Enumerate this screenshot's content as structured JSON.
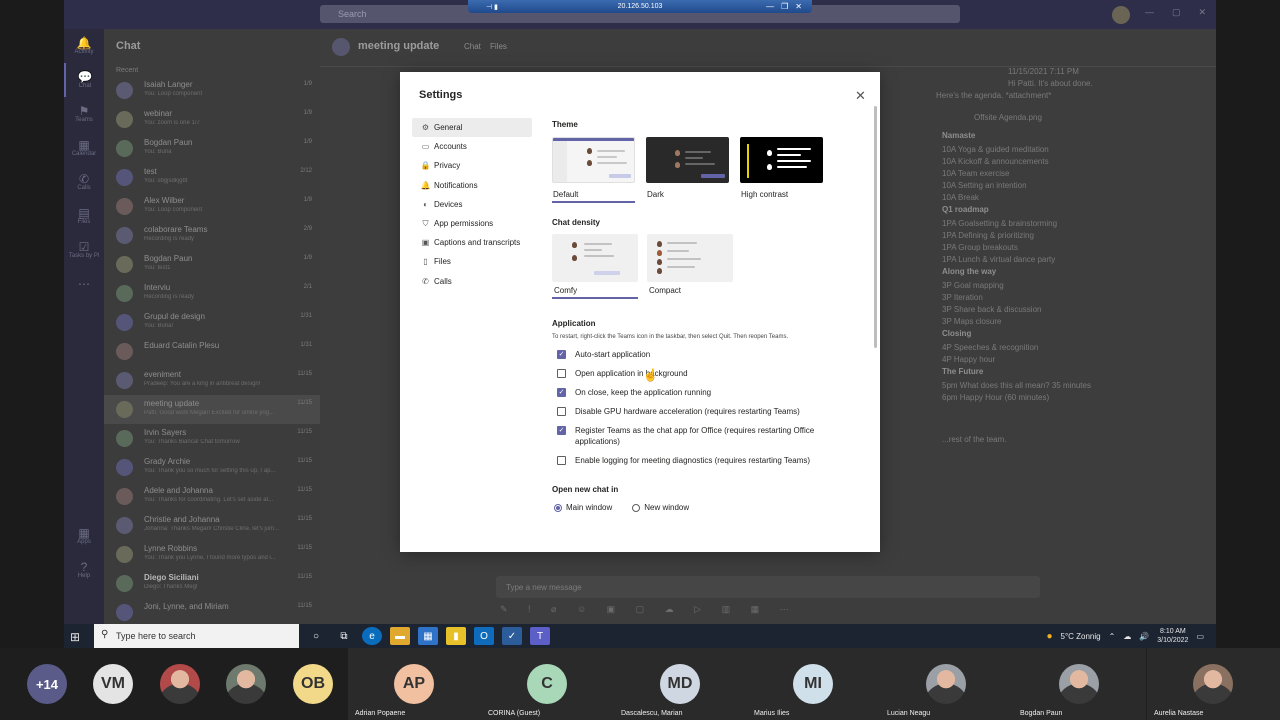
{
  "remote": {
    "host": "20.126.50.103",
    "teams": {
      "search_placeholder": "Search",
      "rail": [
        {
          "label": "Activity",
          "glyph": "🔔"
        },
        {
          "label": "Chat",
          "glyph": "💬"
        },
        {
          "label": "Teams",
          "glyph": "⚑"
        },
        {
          "label": "Calendar",
          "glyph": "▦"
        },
        {
          "label": "Calls",
          "glyph": "✆"
        },
        {
          "label": "Files",
          "glyph": "▤"
        },
        {
          "label": "Tasks by Pl",
          "glyph": "☑"
        },
        {
          "label": "",
          "glyph": "⋯"
        }
      ],
      "rail_bottom": [
        {
          "label": "Apps",
          "glyph": "▦"
        },
        {
          "label": "Help",
          "glyph": "?"
        }
      ],
      "chat_title": "Chat",
      "recent_label": "Recent",
      "chats": [
        {
          "name": "Isaiah Langer",
          "preview": "You: Loop component",
          "time": "1/9"
        },
        {
          "name": "webinar",
          "preview": "You: zoom is one 1/7",
          "time": "1/9"
        },
        {
          "name": "Bogdan Paun",
          "preview": "You: Buna",
          "time": "1/9"
        },
        {
          "name": "test",
          "preview": "You: sbgjsdkjgbt",
          "time": "2/12"
        },
        {
          "name": "Alex Wilber",
          "preview": "You: Loop component",
          "time": "1/9"
        },
        {
          "name": "colaborare Teams",
          "preview": "Recording is ready",
          "time": "2/9"
        },
        {
          "name": "Bogdan Paun",
          "preview": "You: test1",
          "time": "1/9"
        },
        {
          "name": "Interviu",
          "preview": "Recording is ready",
          "time": "2/1"
        },
        {
          "name": "Grupul de design",
          "preview": "You: Buna!",
          "time": "1/31"
        },
        {
          "name": "Eduard Catalin Plesu",
          "preview": "",
          "time": "1/31"
        },
        {
          "name": "eveniment",
          "preview": "Pradeep: You are a king in antibreat design!",
          "time": "11/15"
        },
        {
          "name": "meeting update",
          "preview": "Patti: Good work Megan! Excited for online yog...",
          "time": "11/15"
        },
        {
          "name": "Irvin Sayers",
          "preview": "You: Thanks Bianca! Chat tomorrow",
          "time": "11/15"
        },
        {
          "name": "Grady Archie",
          "preview": "You: Thank you so much for setting this up, I ap...",
          "time": "11/15"
        },
        {
          "name": "Adele and Johanna",
          "preview": "You: Thanks for coordinating. Let's set aside at...",
          "time": "11/15"
        },
        {
          "name": "Christie and Johanna",
          "preview": "Johanna: Thanks Megan! Christie Cline, let's jum...",
          "time": "11/15"
        },
        {
          "name": "Lynne Robbins",
          "preview": "You: Thank you Lynne, I found more typos and i...",
          "time": "11/15"
        },
        {
          "name": "Diego Siciliani",
          "preview": "Diego: Thanks Meg!",
          "time": "11/15"
        },
        {
          "name": "Joni, Lynne, and Miriam",
          "preview": "",
          "time": "11/15"
        }
      ],
      "conversation": {
        "title": "meeting update",
        "tabs": [
          "Chat",
          "Files"
        ],
        "messages": [
          {
            "text": "11/15/2021 7:11 PM",
            "head": false
          },
          {
            "text": "Hi Patti. It's about done.",
            "head": false
          },
          {
            "text": "Here's the agenda. *attachment*",
            "head": false
          },
          {
            "text": "Offsite Agenda.png",
            "head": false
          },
          {
            "text": "Namaste",
            "head": true
          },
          {
            "text": "10A Yoga & guided meditation",
            "head": false
          },
          {
            "text": "10A Kickoff & announcements",
            "head": false
          },
          {
            "text": "10A Team exercise",
            "head": false
          },
          {
            "text": "10A Setting an intention",
            "head": false
          },
          {
            "text": "10A Break",
            "head": false
          },
          {
            "text": "Q1 roadmap",
            "head": true
          },
          {
            "text": "1PA Goalsetting & brainstorming",
            "head": false
          },
          {
            "text": "1PA Defining & prioritizing",
            "head": false
          },
          {
            "text": "1PA Group breakouts",
            "head": false
          },
          {
            "text": "1PA Lunch & virtual dance party",
            "head": false
          },
          {
            "text": "Along the way",
            "head": true
          },
          {
            "text": "3P Goal mapping",
            "head": false
          },
          {
            "text": "3P Iteration",
            "head": false
          },
          {
            "text": "3P Share back & discussion",
            "head": false
          },
          {
            "text": "3P Maps closure",
            "head": false
          },
          {
            "text": "Closing",
            "head": true
          },
          {
            "text": "4P Speeches & recognition",
            "head": false
          },
          {
            "text": "4P Happy hour",
            "head": false
          },
          {
            "text": "The Future",
            "head": true
          },
          {
            "text": "5pm What does this all mean? 35 minutes",
            "head": false
          },
          {
            "text": "6pm Happy Hour (60 minutes)",
            "head": false
          },
          {
            "text": "...rest of the team.",
            "head": false
          }
        ],
        "compose_placeholder": "Type a new message"
      }
    },
    "taskbar": {
      "search_placeholder": "Type here to search",
      "weather": "5°C Zonnig",
      "time": "8:10 AM",
      "date": "3/10/2022"
    }
  },
  "settings": {
    "title": "Settings",
    "nav": [
      {
        "label": "General",
        "icon": "gear-icon",
        "glyph": "⚙"
      },
      {
        "label": "Accounts",
        "icon": "id-card-icon",
        "glyph": "▭"
      },
      {
        "label": "Privacy",
        "icon": "lock-icon",
        "glyph": "🔒"
      },
      {
        "label": "Notifications",
        "icon": "bell-icon",
        "glyph": "🔔"
      },
      {
        "label": "Devices",
        "icon": "speaker-icon",
        "glyph": "◐"
      },
      {
        "label": "App permissions",
        "icon": "shield-icon",
        "glyph": "⛉"
      },
      {
        "label": "Captions and transcripts",
        "icon": "captions-icon",
        "glyph": "▣"
      },
      {
        "label": "Files",
        "icon": "file-icon",
        "glyph": "▯"
      },
      {
        "label": "Calls",
        "icon": "phone-icon",
        "glyph": "✆"
      }
    ],
    "theme_heading": "Theme",
    "themes": [
      {
        "label": "Default",
        "selected": true
      },
      {
        "label": "Dark",
        "selected": false
      },
      {
        "label": "High contrast",
        "selected": false
      }
    ],
    "density_heading": "Chat density",
    "densities": [
      {
        "label": "Comfy",
        "selected": true
      },
      {
        "label": "Compact",
        "selected": false
      }
    ],
    "application_heading": "Application",
    "application_desc": "To restart, right-click the Teams icon in the taskbar, then select Quit. Then reopen Teams.",
    "options": [
      {
        "label": "Auto-start application",
        "checked": true
      },
      {
        "label": "Open application in background",
        "checked": false
      },
      {
        "label": "On close, keep the application running",
        "checked": true
      },
      {
        "label": "Disable GPU hardware acceleration (requires restarting Teams)",
        "checked": false
      },
      {
        "label": "Register Teams as the chat app for Office (requires restarting Office applications)",
        "checked": true
      },
      {
        "label": "Enable logging for meeting diagnostics (requires restarting Teams)",
        "checked": false
      }
    ],
    "open_chat_heading": "Open new chat in",
    "open_chat_options": [
      {
        "label": "Main window",
        "selected": true
      },
      {
        "label": "New window",
        "selected": false
      }
    ],
    "accent_color": "#6264a7"
  },
  "participants": {
    "overflow_count": "+14",
    "tiles": [
      {
        "initials": "VM",
        "name": "",
        "color": "#e4e4e4",
        "photo": false
      },
      {
        "initials": "",
        "name": "",
        "color": "#b34a4a",
        "photo": true
      },
      {
        "initials": "",
        "name": "",
        "color": "#6e7a6e",
        "photo": true
      },
      {
        "initials": "OB",
        "name": "",
        "color": "#f2d98a",
        "photo": false
      },
      {
        "initials": "AP",
        "name": "Adrian Popaene",
        "color": "#f0c0a0",
        "photo": false
      },
      {
        "initials": "C",
        "name": "CORINA (Guest)",
        "color": "#a8d8b8",
        "photo": false
      },
      {
        "initials": "MD",
        "name": "Dascalescu, Marian",
        "color": "#cfd8e2",
        "photo": false
      },
      {
        "initials": "MI",
        "name": "Marius  Ilies",
        "color": "#cfe0ea",
        "photo": false
      },
      {
        "initials": "",
        "name": "Lucian Neagu",
        "color": "#9aa0a6",
        "photo": true
      },
      {
        "initials": "",
        "name": "Bogdan Paun",
        "color": "#9aa0a6",
        "photo": true
      },
      {
        "initials": "",
        "name": "Aurelia Nastase",
        "color": "#8a7060",
        "photo": true
      }
    ]
  }
}
